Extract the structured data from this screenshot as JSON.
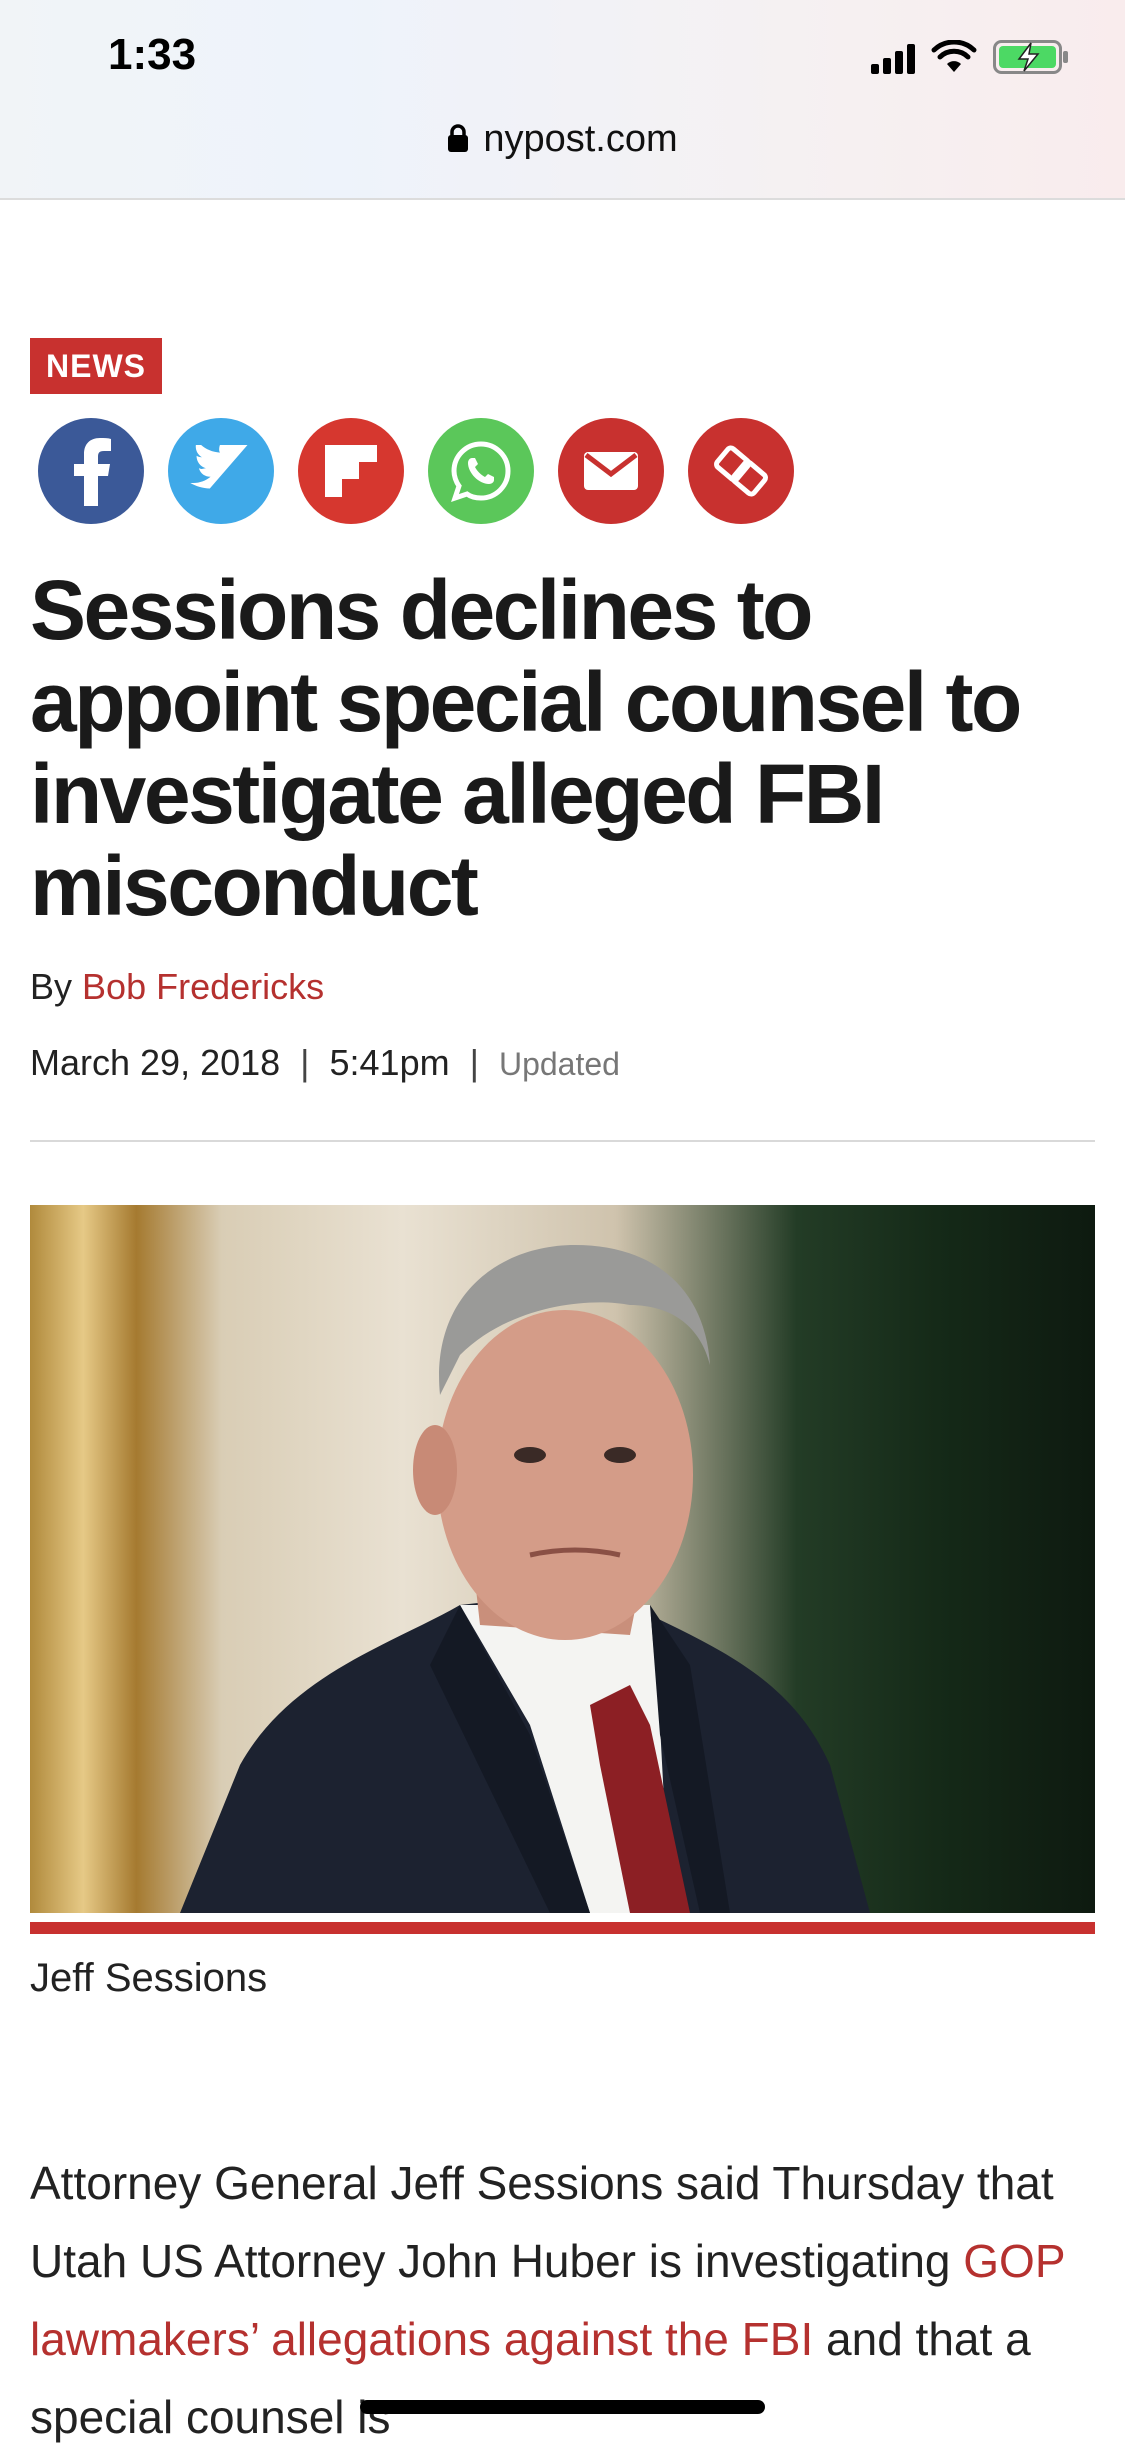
{
  "status_bar": {
    "time": "1:33",
    "signal_bars": 4,
    "wifi_icon": "wifi-icon",
    "battery_icon": "battery-charging-icon",
    "battery_color": "#4cd964"
  },
  "url_bar": {
    "lock_icon": "lock-icon",
    "domain": "nypost.com"
  },
  "article": {
    "section_badge": "NEWS",
    "share_buttons": [
      {
        "icon": "facebook-icon",
        "color": "#3b5998"
      },
      {
        "icon": "twitter-icon",
        "color": "#3fa9e8"
      },
      {
        "icon": "flipboard-icon",
        "color": "#d6372f"
      },
      {
        "icon": "whatsapp-icon",
        "color": "#5bc75a"
      },
      {
        "icon": "email-icon",
        "color": "#c8312f"
      },
      {
        "icon": "copy-link-icon",
        "color": "#c8312f"
      }
    ],
    "headline": "Sessions declines to appoint special counsel to investigate alleged FBI misconduct",
    "byline_prefix": "By",
    "author": "Bob Fredericks",
    "date": "March 29, 2018",
    "time": "5:41pm",
    "date_separator": "|",
    "updated_label": "Updated",
    "photo_caption": "Jeff Sessions",
    "body": {
      "part1": "Attorney General Jeff Sessions said Thursday that Utah US Attorney John Huber is investigating ",
      "link": "GOP lawmakers’ allegations against the FBI",
      "part2": " and that a special counsel is"
    }
  },
  "colors": {
    "accent": "#c8312f",
    "link": "#b5312f",
    "text": "#222222"
  }
}
